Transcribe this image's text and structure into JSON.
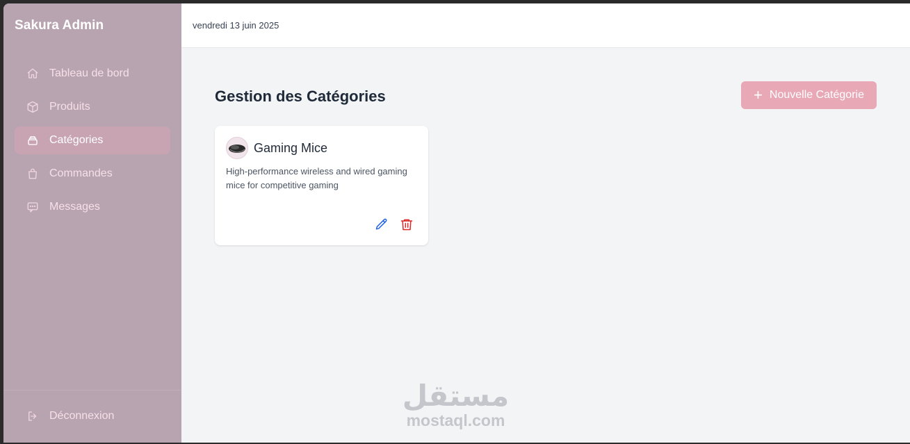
{
  "sidebar": {
    "brand": "Sakura Admin",
    "items": [
      {
        "label": "Tableau de bord",
        "icon": "home-icon",
        "active": false
      },
      {
        "label": "Produits",
        "icon": "box-icon",
        "active": false
      },
      {
        "label": "Catégories",
        "icon": "layers-icon",
        "active": true
      },
      {
        "label": "Commandes",
        "icon": "shopping-bag-icon",
        "active": false
      },
      {
        "label": "Messages",
        "icon": "message-icon",
        "active": false
      }
    ],
    "logout_label": "Déconnexion"
  },
  "header": {
    "date": "vendredi 13 juin 2025"
  },
  "main": {
    "title": "Gestion des Catégories",
    "new_button_label": "Nouvelle Catégorie",
    "categories": [
      {
        "name": "Gaming Mice",
        "description": "High-performance wireless and wired gaming mice for competitive gaming"
      }
    ]
  },
  "watermark": {
    "arabic": "مستقل",
    "latin": "mostaql.com"
  },
  "colors": {
    "sidebar_bg": "#b8a4b0",
    "sidebar_active": "#c8a4b2",
    "accent_button": "#e8a8b6",
    "edit_icon": "#2563eb",
    "delete_icon": "#dc2626"
  }
}
